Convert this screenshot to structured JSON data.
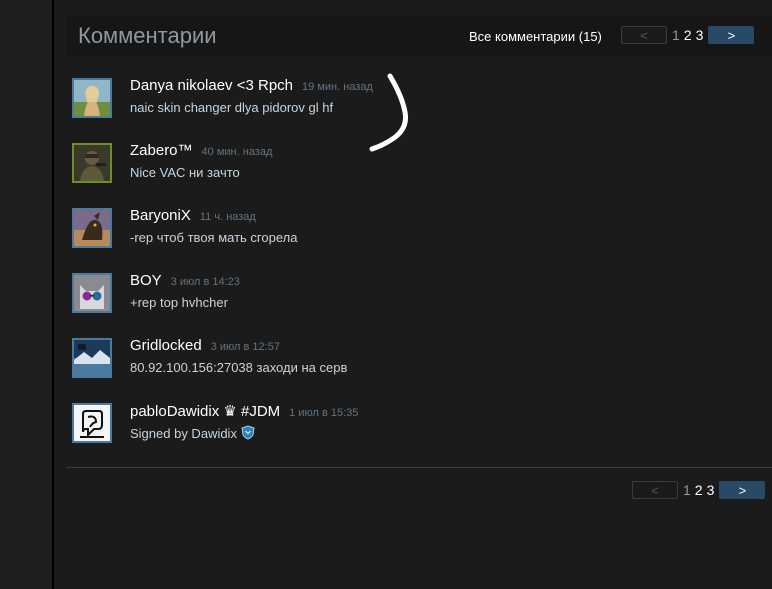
{
  "header": {
    "title": "Комментарии",
    "all_comments": "Все комментарии (15)"
  },
  "pager": {
    "prev_label": "<",
    "next_label": ">",
    "pages": [
      "1",
      "2",
      "3"
    ],
    "current_page": "1"
  },
  "comments": [
    {
      "author": "Danya nikolaev <3 Rpch",
      "timestamp": "19 мин. назад",
      "text": "naic skin changer dlya pidorov gl hf"
    },
    {
      "author": "Zabero™",
      "timestamp": "40 мин. назад",
      "text": "Nice VAC ни зачто"
    },
    {
      "author": "BaryoniX",
      "timestamp": "11 ч. назад",
      "text": "-rep чтоб твоя мать сгорела"
    },
    {
      "author": "BOY",
      "timestamp": "3 июл в 14:23",
      "text": "+rep top hvhcher"
    },
    {
      "author": "Gridlocked",
      "timestamp": "3 июл в 12:57",
      "text": "80.92.100.156:27038 заходи на серв"
    },
    {
      "author": "pabloDawidix ♛ #JDM",
      "timestamp": "1 июл в 15:35",
      "text": "Signed by Dawidix"
    }
  ],
  "colors": {
    "background": "#1b1b1b",
    "header_bg": "#161616",
    "accent_button": "#284a66",
    "author_text": "#ffffff",
    "comment_text": "#c6d4df",
    "timestamp_text": "#63737f"
  }
}
